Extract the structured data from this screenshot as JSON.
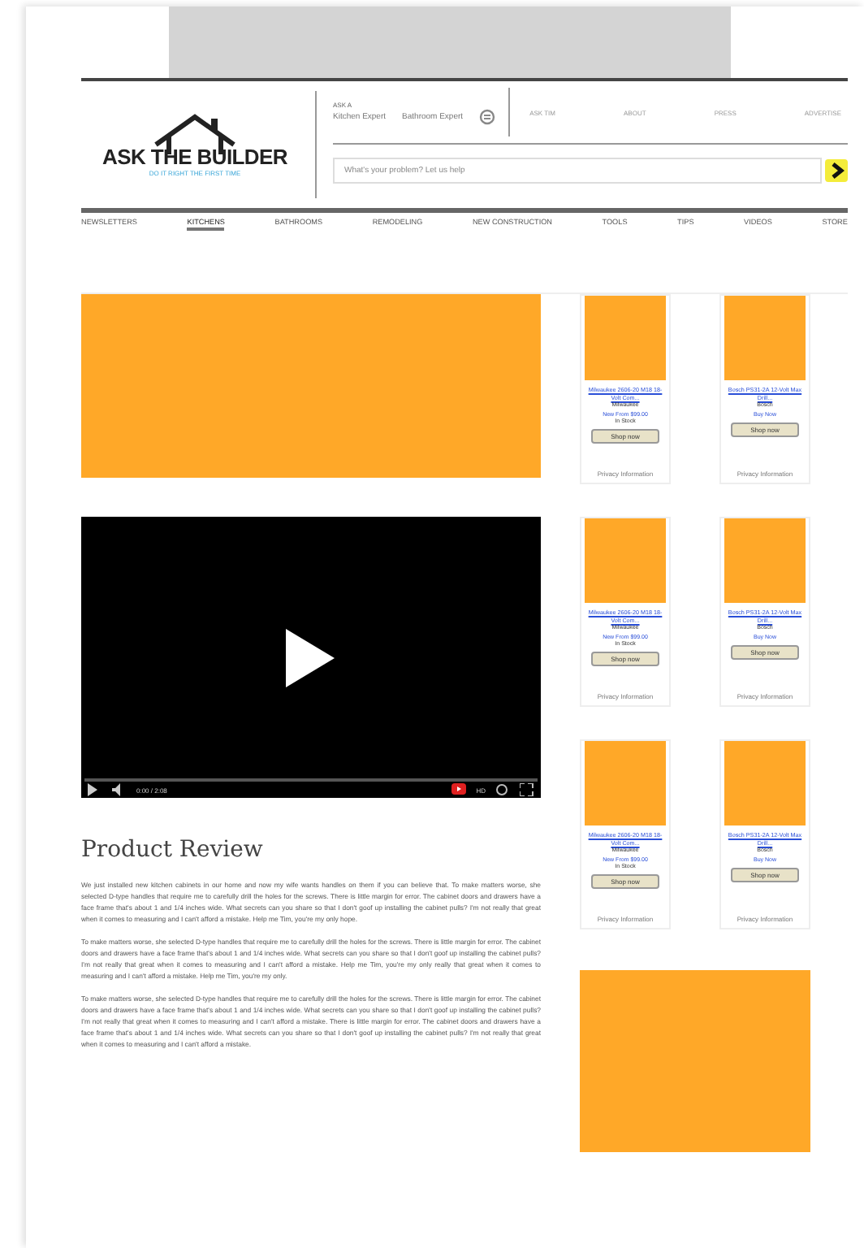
{
  "header": {
    "logo": {
      "title": "ASK THE BUILDER",
      "tagline": "DO IT RIGHT THE FIRST TIME"
    },
    "contact": {
      "label": "ASK A",
      "links": [
        "Kitchen Expert",
        "Bathroom Expert"
      ]
    },
    "top_links": [
      "ASK TIM",
      "ABOUT",
      "PRESS",
      "ADVERTISE"
    ],
    "search": {
      "placeholder": "What's your problem? Let us help"
    }
  },
  "nav": [
    {
      "label": "NEWSLETTERS",
      "selected": false
    },
    {
      "label": "KITCHENS",
      "selected": true
    },
    {
      "label": "BATHROOMS",
      "selected": false
    },
    {
      "label": "REMODELING",
      "selected": false
    },
    {
      "label": "NEW CONSTRUCTION",
      "selected": false
    },
    {
      "label": "TOOLS",
      "selected": false
    },
    {
      "label": "TIPS",
      "selected": false
    },
    {
      "label": "VIDEOS",
      "selected": false
    },
    {
      "label": "STORE",
      "selected": false
    }
  ],
  "video": {
    "time": "0:00 / 2:08",
    "quality": "HD"
  },
  "article": {
    "title": "Product Review",
    "paragraphs": [
      "We just installed new kitchen cabinets in our home and now my wife wants handles on them if you can believe that. To make matters worse, she selected D-type handles that require me to carefully drill the holes for the screws. There is little margin for error. The cabinet doors and drawers have a face frame that's about 1 and 1/4 inches wide. What secrets can you share so that I don't goof up installing the cabinet pulls? I'm not really that great when it comes to measuring and I can't afford a mistake. Help me Tim, you're my only hope.",
      "To make matters worse, she selected D-type handles that require me to carefully drill the holes for the screws. There is little margin for error. The cabinet doors and drawers have a face frame that's about 1 and 1/4 inches wide. What secrets can you share so that I don't goof up installing the cabinet pulls? I'm not really that great when it comes to measuring and I can't afford a mistake. Help me Tim, you're my only really that great when it comes to measuring and I can't afford a mistake. Help me Tim, you're my only.",
      "To make matters worse, she selected D-type handles that require me to carefully drill the holes for the screws. There is little margin for error. The cabinet doors and drawers have a face frame that's about 1 and 1/4 inches wide. What secrets can you share so that I don't goof up installing the cabinet pulls? I'm not really that great when it comes to measuring and I can't afford a mistake. There is little margin for error. The cabinet doors and drawers have a face frame that's about 1 and 1/4 inches wide. What secrets can you share so that I don't goof up installing the cabinet pulls? I'm not really that great when it comes to measuring and I can't afford a mistake."
    ]
  },
  "products": [
    {
      "title": "Milwaukee 2606-20 M18 18-Volt Com...",
      "brand": "Milwaukee",
      "price": "New From $99.00",
      "shipping": "In Stock",
      "button": "Shop now",
      "footer": "Privacy Information"
    },
    {
      "title": "Bosch PS31-2A 12-Volt Max Drill...",
      "brand": "Bosch",
      "price": "Buy Now",
      "button": "Shop now",
      "footer": "Privacy Information"
    },
    {
      "title": "Milwaukee 2606-20 M18 18-Volt Com...",
      "brand": "Milwaukee",
      "price": "New From $99.00",
      "shipping": "In Stock",
      "button": "Shop now",
      "footer": "Privacy Information"
    },
    {
      "title": "Bosch PS31-2A 12-Volt Max Drill...",
      "brand": "Bosch",
      "price": "Buy Now",
      "button": "Shop now",
      "footer": "Privacy Information"
    },
    {
      "title": "Milwaukee 2606-20 M18 18-Volt Com...",
      "brand": "Milwaukee",
      "price": "New From $99.00",
      "shipping": "In Stock",
      "button": "Shop now",
      "footer": "Privacy Information"
    },
    {
      "title": "Bosch PS31-2A 12-Volt Max Drill...",
      "brand": "Bosch",
      "price": "Buy Now",
      "button": "Shop now",
      "footer": "Privacy Information"
    }
  ]
}
